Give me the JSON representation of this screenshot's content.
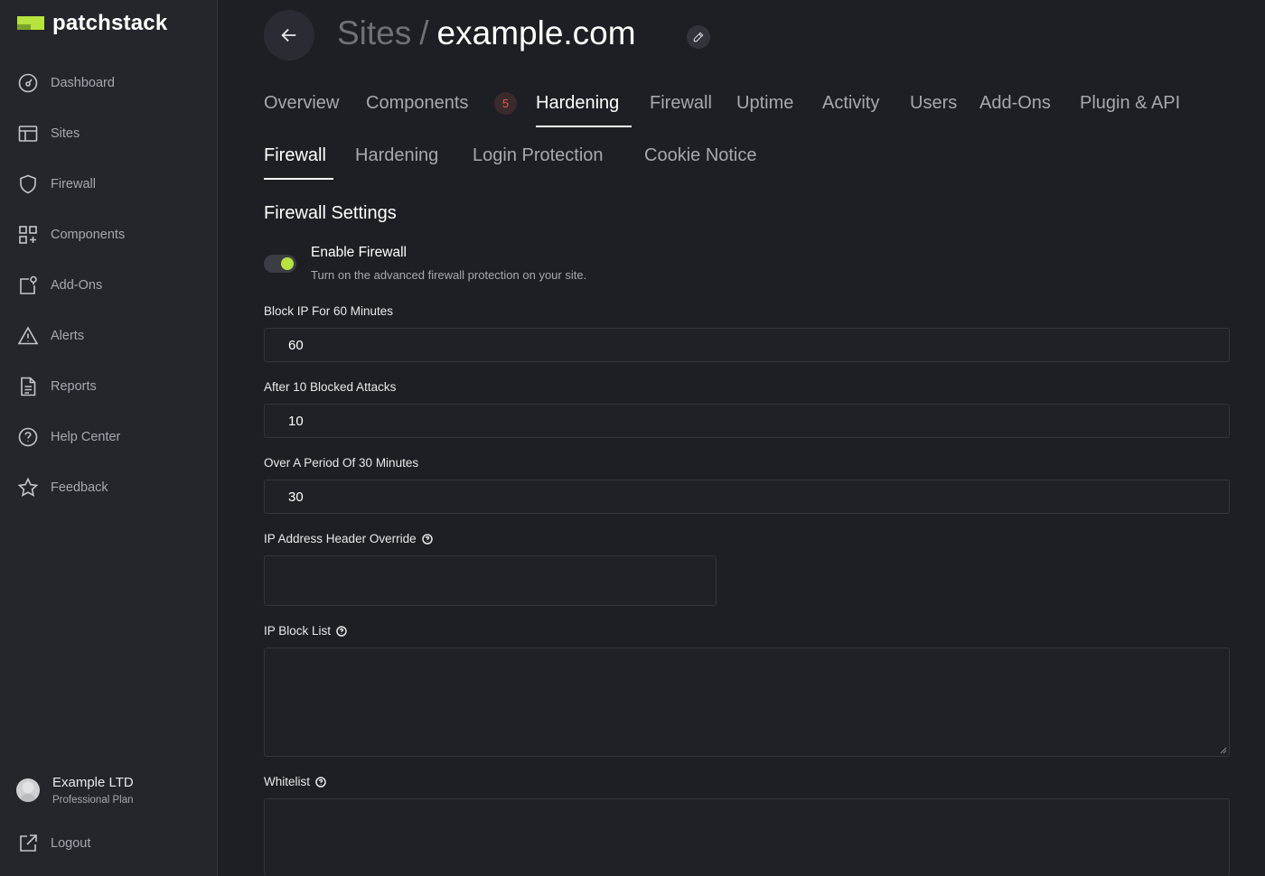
{
  "brand": {
    "name": "patchstack",
    "accent": "#b7e33f"
  },
  "sidebar": {
    "items": [
      {
        "label": "Dashboard",
        "icon": "dashboard-gauge-icon"
      },
      {
        "label": "Sites",
        "icon": "sites-browser-icon"
      },
      {
        "label": "Firewall",
        "icon": "shield-icon"
      },
      {
        "label": "Components",
        "icon": "components-grid-icon"
      },
      {
        "label": "Add-Ons",
        "icon": "add-ons-icon"
      },
      {
        "label": "Alerts",
        "icon": "alert-triangle-icon"
      },
      {
        "label": "Reports",
        "icon": "report-document-icon"
      },
      {
        "label": "Help Center",
        "icon": "help-circle-icon"
      },
      {
        "label": "Feedback",
        "icon": "star-icon"
      }
    ],
    "account": {
      "name": "Example LTD",
      "plan": "Professional Plan"
    },
    "logout": {
      "label": "Logout",
      "icon": "external-link-icon"
    }
  },
  "header": {
    "breadcrumb": "Sites",
    "separator": "/",
    "site": "example.com"
  },
  "tabs": [
    {
      "label": "Overview"
    },
    {
      "label": "Components",
      "badge": "5"
    },
    {
      "label": "Hardening",
      "active": true
    },
    {
      "label": "Firewall"
    },
    {
      "label": "Uptime"
    },
    {
      "label": "Activity"
    },
    {
      "label": "Users"
    },
    {
      "label": "Add-Ons"
    },
    {
      "label": "Plugin & API"
    }
  ],
  "subtabs": [
    {
      "label": "Firewall",
      "active": true
    },
    {
      "label": "Hardening"
    },
    {
      "label": "Login Protection"
    },
    {
      "label": "Cookie Notice"
    }
  ],
  "settings": {
    "title": "Firewall Settings",
    "enable": {
      "label": "Enable Firewall",
      "description": "Turn on the advanced firewall protection on your site.",
      "on": true
    },
    "block_ip": {
      "label": "Block IP For 60 Minutes",
      "value": "60"
    },
    "after_attacks": {
      "label": "After 10 Blocked Attacks",
      "value": "10"
    },
    "period": {
      "label": "Over A Period Of 30 Minutes",
      "value": "30"
    },
    "ip_header": {
      "label": "IP Address Header Override",
      "value": ""
    },
    "ip_block_list": {
      "label": "IP Block List",
      "value": ""
    },
    "whitelist": {
      "label": "Whitelist",
      "value": ""
    }
  }
}
